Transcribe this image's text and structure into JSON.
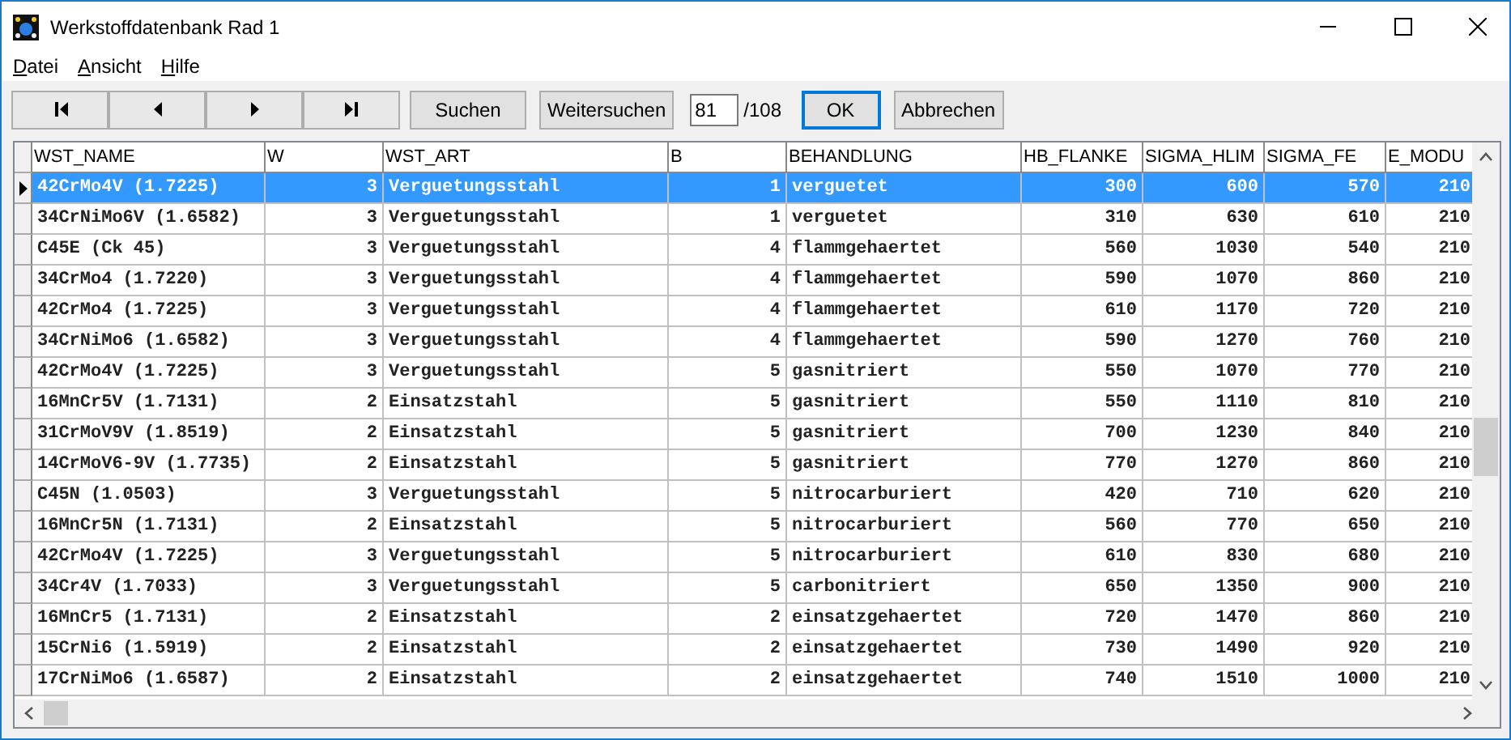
{
  "window": {
    "title": "Werkstoffdatenbank Rad 1"
  },
  "menu": [
    "Datei",
    "Ansicht",
    "Hilfe"
  ],
  "toolbar": {
    "nav_buttons": [
      {
        "kind": "first"
      },
      {
        "kind": "prev"
      },
      {
        "kind": "next"
      },
      {
        "kind": "last"
      }
    ],
    "search_button": "Suchen",
    "next_search_button": "Weitersuchen",
    "record_field": {
      "value": "81"
    },
    "record_total": "/108",
    "ok_button": {
      "label": "OK",
      "focused": true
    },
    "cancel_button": {
      "label": "Abbrechen",
      "focused": false
    }
  },
  "table": {
    "columns": [
      "WST_NAME",
      "W",
      "WST_ART",
      "B",
      "BEHANDLUNG",
      "HB_FLANKE",
      "SIGMA_HLIM",
      "SIGMA_FE",
      "E_MODU"
    ],
    "rows": [
      {
        "selected": true,
        "cells": [
          "42CrMo4V (1.7225)",
          "3",
          "Verguetungsstahl",
          "1",
          "verguetet",
          "300",
          "600",
          "570",
          "210"
        ]
      },
      {
        "selected": false,
        "cells": [
          "34CrNiMo6V (1.6582)",
          "3",
          "Verguetungsstahl",
          "1",
          "verguetet",
          "310",
          "630",
          "610",
          "210"
        ]
      },
      {
        "selected": false,
        "cells": [
          "C45E (Ck 45)",
          "3",
          "Verguetungsstahl",
          "4",
          "flammgehaertet",
          "560",
          "1030",
          "540",
          "210"
        ]
      },
      {
        "selected": false,
        "cells": [
          "34CrMo4 (1.7220)",
          "3",
          "Verguetungsstahl",
          "4",
          "flammgehaertet",
          "590",
          "1070",
          "860",
          "210"
        ]
      },
      {
        "selected": false,
        "cells": [
          "42CrMo4 (1.7225)",
          "3",
          "Verguetungsstahl",
          "4",
          "flammgehaertet",
          "610",
          "1170",
          "720",
          "210"
        ]
      },
      {
        "selected": false,
        "cells": [
          "34CrNiMo6 (1.6582)",
          "3",
          "Verguetungsstahl",
          "4",
          "flammgehaertet",
          "590",
          "1270",
          "760",
          "210"
        ]
      },
      {
        "selected": false,
        "cells": [
          "42CrMo4V (1.7225)",
          "3",
          "Verguetungsstahl",
          "5",
          "gasnitriert",
          "550",
          "1070",
          "770",
          "210"
        ]
      },
      {
        "selected": false,
        "cells": [
          "16MnCr5V (1.7131)",
          "2",
          "Einsatzstahl",
          "5",
          "gasnitriert",
          "550",
          "1110",
          "810",
          "210"
        ]
      },
      {
        "selected": false,
        "cells": [
          "31CrMoV9V (1.8519)",
          "2",
          "Einsatzstahl",
          "5",
          "gasnitriert",
          "700",
          "1230",
          "840",
          "210"
        ]
      },
      {
        "selected": false,
        "cells": [
          "14CrMoV6-9V (1.7735)",
          "2",
          "Einsatzstahl",
          "5",
          "gasnitriert",
          "770",
          "1270",
          "860",
          "210"
        ]
      },
      {
        "selected": false,
        "cells": [
          "C45N (1.0503)",
          "3",
          "Verguetungsstahl",
          "5",
          "nitrocarburiert",
          "420",
          "710",
          "620",
          "210"
        ]
      },
      {
        "selected": false,
        "cells": [
          "16MnCr5N (1.7131)",
          "2",
          "Einsatzstahl",
          "5",
          "nitrocarburiert",
          "560",
          "770",
          "650",
          "210"
        ]
      },
      {
        "selected": false,
        "cells": [
          "42CrMo4V (1.7225)",
          "3",
          "Verguetungsstahl",
          "5",
          "nitrocarburiert",
          "610",
          "830",
          "680",
          "210"
        ]
      },
      {
        "selected": false,
        "cells": [
          "34Cr4V (1.7033)",
          "3",
          "Verguetungsstahl",
          "5",
          "carbonitriert",
          "650",
          "1350",
          "900",
          "210"
        ]
      },
      {
        "selected": false,
        "cells": [
          "16MnCr5 (1.7131)",
          "2",
          "Einsatzstahl",
          "2",
          "einsatzgehaertet",
          "720",
          "1470",
          "860",
          "210"
        ]
      },
      {
        "selected": false,
        "cells": [
          "15CrNi6 (1.5919)",
          "2",
          "Einsatzstahl",
          "2",
          "einsatzgehaertet",
          "730",
          "1490",
          "920",
          "210"
        ]
      },
      {
        "selected": false,
        "cells": [
          "17CrNiMo6 (1.6587)",
          "2",
          "Einsatzstahl",
          "2",
          "einsatzgehaertet",
          "740",
          "1510",
          "1000",
          "210"
        ]
      }
    ]
  }
}
